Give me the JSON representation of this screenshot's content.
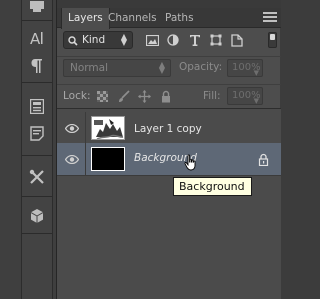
{
  "panel": {
    "tabs": [
      {
        "label": "Layers",
        "active": true
      },
      {
        "label": "Channels",
        "active": false
      },
      {
        "label": "Paths",
        "active": false
      }
    ],
    "menu_icon": "panel-menu-icon"
  },
  "filter": {
    "kind_label": "Kind",
    "icons": [
      "pixel-filter-icon",
      "adjustment-filter-icon",
      "type-filter-icon",
      "shape-filter-icon",
      "smart-object-filter-icon"
    ]
  },
  "blend": {
    "mode": "Normal",
    "opacity_label": "Opacity:",
    "opacity_value": "100%",
    "fill_label": "Fill:",
    "fill_value": "100%"
  },
  "lock": {
    "label": "Lock:",
    "icons": [
      "lock-transparent-icon",
      "lock-image-icon",
      "lock-position-icon",
      "lock-all-icon"
    ]
  },
  "layers": [
    {
      "name": "Layer 1 copy",
      "visible": true,
      "selected": false,
      "locked": false
    },
    {
      "name": "Background",
      "visible": true,
      "selected": true,
      "locked": true
    }
  ],
  "tooltip": {
    "text": "Background"
  },
  "toolbar": {
    "tools": [
      "panel-tool-icon",
      "character-icon",
      "paragraph-icon",
      "properties-icon",
      "notes-icon",
      "tools-icon",
      "3d-cube-icon"
    ]
  },
  "colors": {
    "panel_bg": "#4d4d4d",
    "selected_layer": "#5e6876",
    "tooltip_bg": "#ffffe1"
  }
}
